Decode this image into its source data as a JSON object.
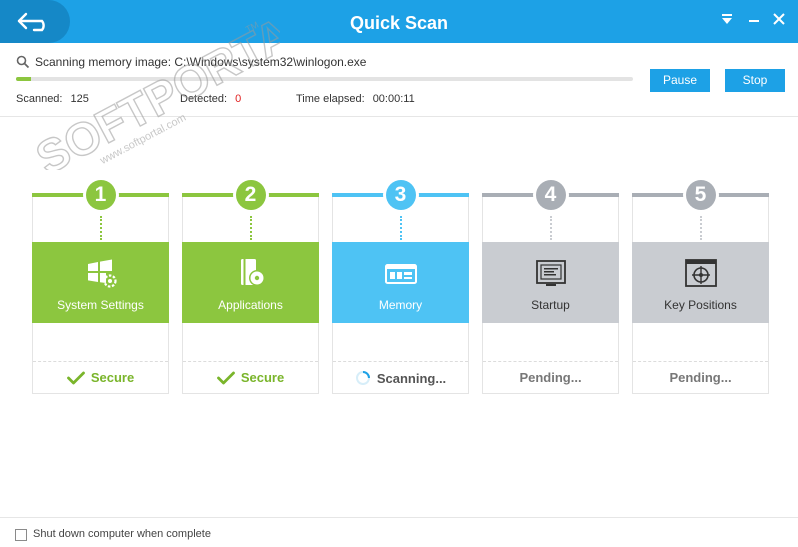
{
  "window": {
    "title": "Quick Scan",
    "accent_color": "#1da1e6",
    "controls": [
      "dropdown-icon",
      "minimize-icon",
      "close-icon"
    ]
  },
  "status": {
    "scanning_text": "Scanning memory image: C:\\Windows\\system32\\winlogon.exe",
    "progress_fraction": 0.024,
    "scanned_label": "Scanned:",
    "scanned_value": "125",
    "detected_label": "Detected:",
    "detected_value": "0",
    "time_label": "Time elapsed:",
    "time_value": "00:00:11",
    "pause_label": "Pause",
    "stop_label": "Stop"
  },
  "steps": [
    {
      "number": "1",
      "label": "System Settings",
      "state": "Secure",
      "status": "done",
      "icon": "windows-settings-icon",
      "color": "#8cc63f"
    },
    {
      "number": "2",
      "label": "Applications",
      "state": "Secure",
      "status": "done",
      "icon": "applications-icon",
      "color": "#8cc63f"
    },
    {
      "number": "3",
      "label": "Memory",
      "state": "Scanning...",
      "status": "active",
      "icon": "memory-icon",
      "color": "#4ec3f4"
    },
    {
      "number": "4",
      "label": "Startup",
      "state": "Pending...",
      "status": "pending",
      "icon": "startup-icon",
      "color": "#a9aeb5"
    },
    {
      "number": "5",
      "label": "Key Positions",
      "state": "Pending...",
      "status": "pending",
      "icon": "key-positions-icon",
      "color": "#a9aeb5"
    }
  ],
  "footer": {
    "shutdown_label": "Shut down computer when complete",
    "shutdown_checked": false
  },
  "watermark": {
    "brand": "SOFTPORTAL",
    "trademark": "TM",
    "url": "www.softportal.com"
  }
}
